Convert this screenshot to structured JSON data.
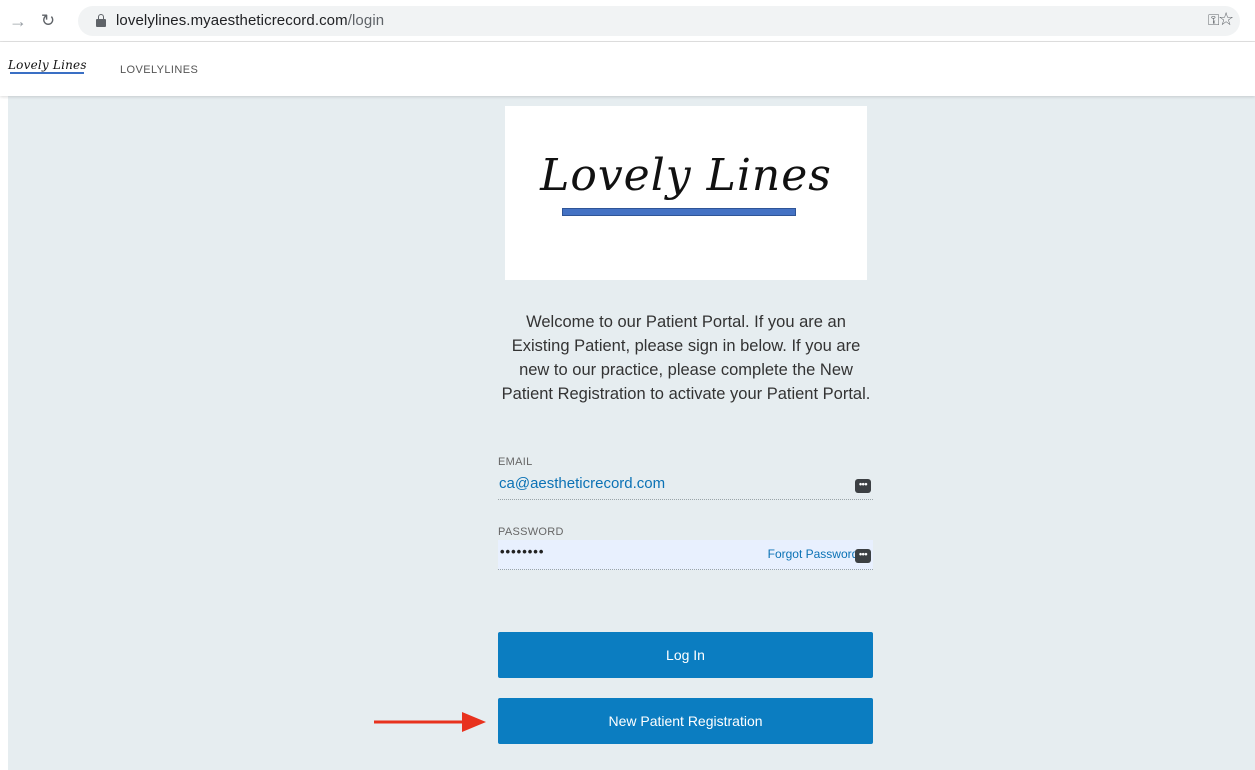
{
  "browser": {
    "url_host": "lovelylines.myaestheticrecord.com",
    "url_path": "/login",
    "icons": {
      "forward": "forward-arrow-icon",
      "reload": "reload-icon",
      "lock": "lock-icon",
      "key": "key-icon",
      "star": "star-icon"
    }
  },
  "header": {
    "logo_text": "Lovely Lines",
    "brand": "LOVELYLINES"
  },
  "logo_card": {
    "text": "Lovely Lines",
    "underline_color": "#4472c4"
  },
  "welcome_text": "Welcome to our Patient Portal. If you are an Existing Patient, please sign in below. If you are new to our practice, please complete the New Patient Registration to activate your Patient Portal.",
  "form": {
    "email_label": "EMAIL",
    "email_value": "ca@aestheticrecord.com",
    "password_label": "PASSWORD",
    "password_value": "••••••••",
    "forgot_label": "Forgot Password?",
    "autofill_badge": "•••"
  },
  "buttons": {
    "login": "Log In",
    "register": "New Patient Registration"
  },
  "colors": {
    "accent": "#0b7dc1",
    "background": "#e6edf0",
    "annotation_arrow": "#e8321e"
  }
}
